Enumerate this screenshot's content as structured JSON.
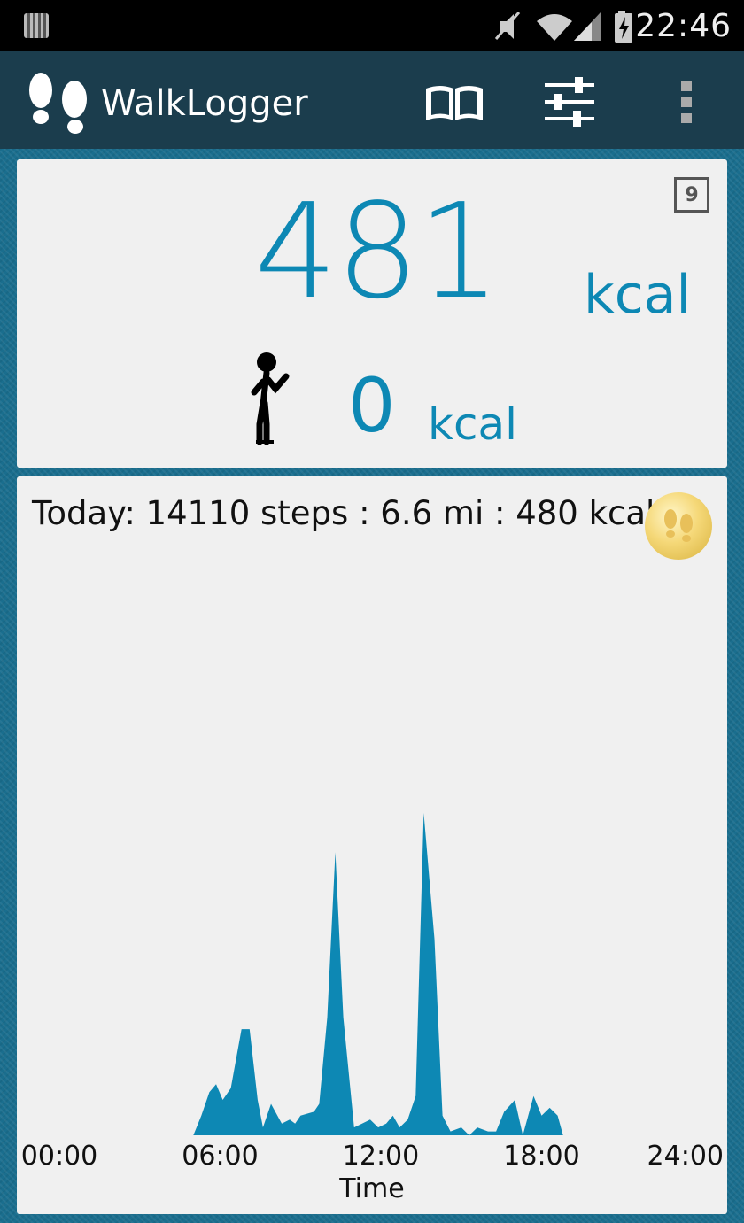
{
  "status_bar": {
    "time": "22:46",
    "icons": [
      "notification-icon",
      "mute-icon",
      "wifi-icon",
      "signal-icon",
      "battery-charging-icon"
    ]
  },
  "app_bar": {
    "title": "WalkLogger",
    "actions": [
      "book-icon",
      "sliders-icon",
      "overflow-menu-icon"
    ]
  },
  "calories": {
    "total_value": "481",
    "total_unit": "kcal",
    "day_badge": "9",
    "current_value": "0",
    "current_unit": "kcal"
  },
  "today": {
    "summary": "Today: 14110 steps : 6.6 mi : 480 kcal"
  },
  "colors": {
    "accent": "#0d88b4",
    "app_bar": "#1b3d4d",
    "panel": "#f0f0f0"
  },
  "chart_data": {
    "type": "area",
    "xlabel": "Time",
    "ylabel": "",
    "tick_labels": [
      "00:00",
      "06:00",
      "12:00",
      "18:00",
      "24:00"
    ],
    "xlim": [
      0,
      24
    ],
    "ylim": [
      0,
      1
    ],
    "x": [
      5.0,
      5.3,
      5.6,
      5.85,
      6.1,
      6.4,
      6.8,
      7.1,
      7.4,
      7.6,
      7.9,
      8.3,
      8.6,
      8.8,
      9.0,
      9.5,
      9.7,
      10.0,
      10.3,
      10.6,
      11.0,
      11.3,
      11.6,
      11.9,
      12.2,
      12.45,
      12.7,
      13.0,
      13.3,
      13.6,
      14.0,
      14.3,
      14.6,
      15.0,
      15.3,
      15.6,
      16.0,
      16.3,
      16.6,
      17.0,
      17.3,
      17.7,
      18.0,
      18.3,
      18.6,
      18.8,
      19.0,
      19.2,
      19.4,
      19.6,
      19.9,
      20.2,
      20.4,
      20.6,
      20.9,
      21.2,
      21.5,
      21.8,
      22.1,
      22.4,
      22.7,
      23.0,
      23.3,
      23.6
    ],
    "y": [
      0.0,
      0.05,
      0.11,
      0.13,
      0.09,
      0.12,
      0.27,
      0.27,
      0.09,
      0.02,
      0.08,
      0.03,
      0.04,
      0.03,
      0.05,
      0.06,
      0.08,
      0.3,
      0.72,
      0.3,
      0.02,
      0.03,
      0.04,
      0.02,
      0.03,
      0.05,
      0.02,
      0.04,
      0.1,
      0.82,
      0.5,
      0.05,
      0.01,
      0.02,
      0.0,
      0.02,
      0.01,
      0.01,
      0.06,
      0.09,
      0.0,
      0.1,
      0.05,
      0.07,
      0.05,
      0.0,
      0.0,
      0.0,
      0.0,
      0.0,
      0.0,
      0.0,
      0.0,
      0.0,
      0.0,
      0.0,
      0.0,
      0.0,
      0.0,
      0.0,
      0.0,
      0.0,
      0.0,
      0.0
    ]
  }
}
